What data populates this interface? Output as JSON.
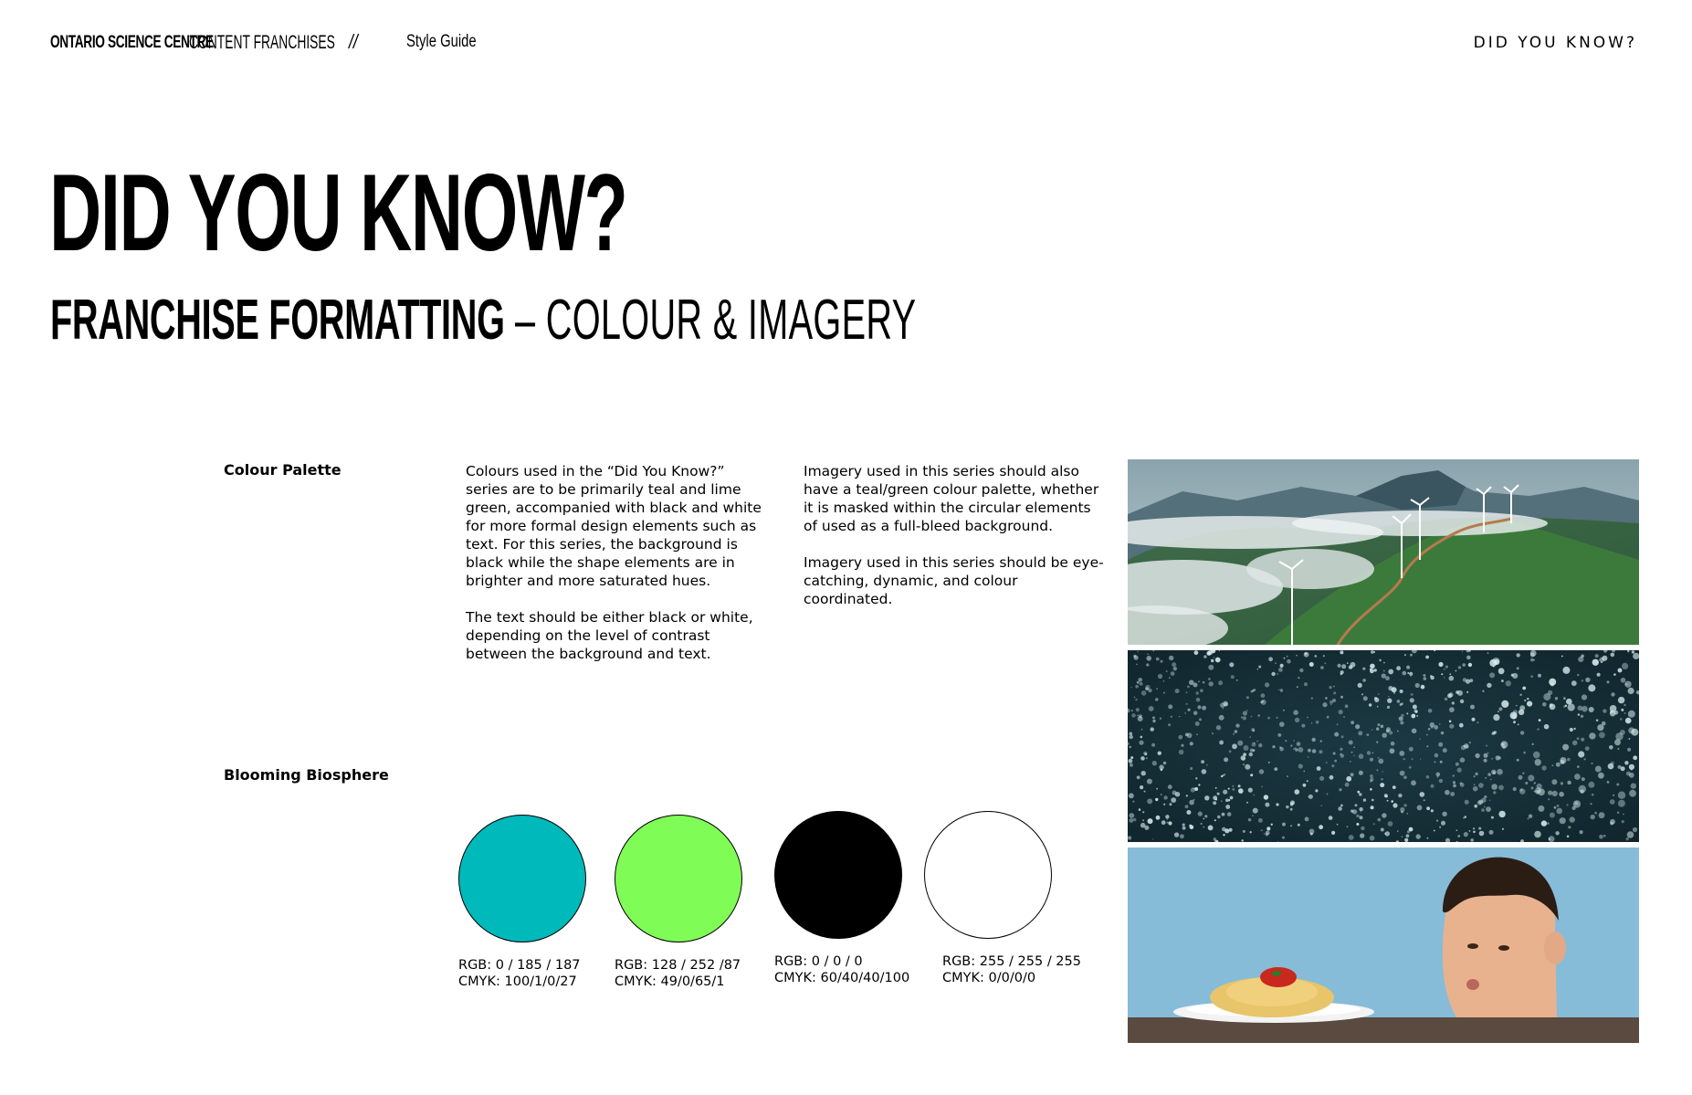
{
  "header": {
    "brand_bold": "ONTARIO SCIENCE CENTRE",
    "brand_light": "CONTENT  FRANCHISES",
    "separator": "//",
    "guide_label": "Style Guide",
    "series_name": "DID YOU KNOW?"
  },
  "title": {
    "main": "DID YOU KNOW?",
    "sub_bold": "FRANCHISE FORMATTING",
    "sub_light": " – COLOUR & IMAGERY"
  },
  "sections": {
    "colour_palette_label": "Colour Palette",
    "palette_name_label": "Blooming Biosphere"
  },
  "colour_text": {
    "p1": "Colours used in the “Did You Know?” series are to be primarily teal and lime green, accompanied with black and white for more formal design elements such as text. For this series, the background is black while the shape elements are in brighter and more saturated hues.",
    "p2": "The text should be either black or white, depending on the level of contrast between the background and text."
  },
  "imagery_text": {
    "p1": "Imagery used in this series should also have a teal/green colour palette, whether it is masked within the circular elements of used as a full-bleed background.",
    "p2": "Imagery used in this series should be eye-catching, dynamic, and colour coordinated."
  },
  "swatches": [
    {
      "color": "#00B9BB",
      "rgb": "RGB: 0 / 185 / 187",
      "cmyk": "CMYK: 100/1/0/27"
    },
    {
      "color": "#80FC57",
      "rgb": "RGB: 128 / 252 /87",
      "cmyk": "CMYK: 49/0/65/1"
    },
    {
      "color": "#000000",
      "rgb": "RGB: 0 / 0 / 0",
      "cmyk": "CMYK: 60/40/40/100"
    },
    {
      "color": "#FFFFFF",
      "rgb": "RGB: 255 / 255 / 255",
      "cmyk": "CMYK: 0/0/0/0"
    }
  ],
  "images": [
    {
      "subject": "wind-farm-mountain-photo"
    },
    {
      "subject": "bubbles-texture-photo"
    },
    {
      "subject": "boy-spaghetti-photo"
    }
  ]
}
